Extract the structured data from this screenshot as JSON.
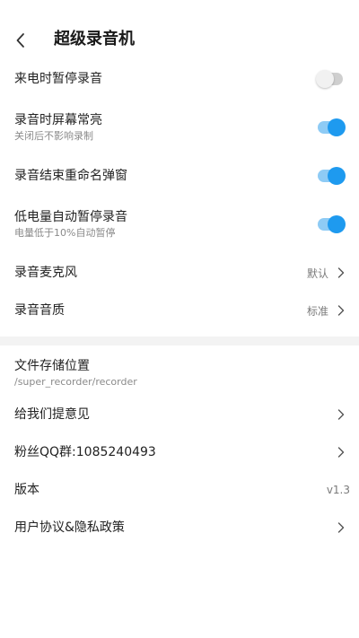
{
  "header": {
    "title": "超级录音机"
  },
  "settings": {
    "call_pause": {
      "label": "来电时暂停录音",
      "on": false
    },
    "screen_on": {
      "label": "录音时屏幕常亮",
      "sub": "关闭后不影响录制",
      "on": true
    },
    "rename_popup": {
      "label": "录音结束重命名弹窗",
      "on": true
    },
    "low_battery": {
      "label": "低电量自动暂停录音",
      "sub": "电量低于10%自动暂停",
      "on": true
    },
    "microphone": {
      "label": "录音麦克风",
      "value": "默认"
    },
    "quality": {
      "label": "录音音质",
      "value": "标准"
    }
  },
  "other": {
    "storage": {
      "label": "文件存储位置",
      "sub": "/super_recorder/recorder"
    },
    "feedback": {
      "label": "给我们提意见"
    },
    "qq_group": {
      "label": "粉丝QQ群:1085240493"
    },
    "version": {
      "label": "版本",
      "value": "v1.3"
    },
    "agreement": {
      "label": "用户协议&隐私政策"
    }
  },
  "colors": {
    "accent": "#1e9aef",
    "accent_track": "#8ecbf5",
    "off_track": "#cfcfcf",
    "divider": "#f3f3f3"
  },
  "icons": {
    "back": "chevron-left-icon",
    "row_arrow": "chevron-right-icon"
  }
}
